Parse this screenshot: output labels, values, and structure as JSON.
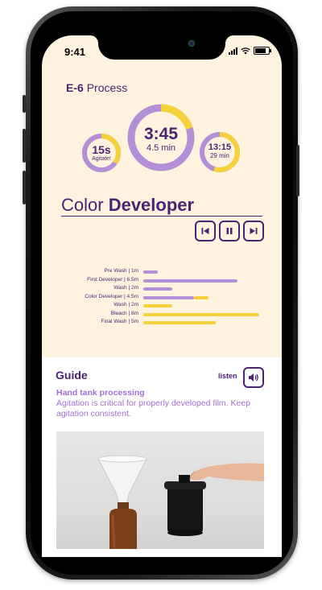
{
  "status": {
    "time": "9:41"
  },
  "process": {
    "code": "E-6",
    "word": "Process"
  },
  "timers": {
    "agitate": {
      "value": "15s",
      "label": "Agitate!",
      "progress": 0.35
    },
    "main": {
      "value": "3:45",
      "sub": "4.5 min",
      "progress": 0.2
    },
    "total": {
      "value": "13:15",
      "sub": "29 min",
      "progress": 0.55
    }
  },
  "step": {
    "prefix": "Color",
    "name": "Developer"
  },
  "controls": {
    "prev": "previous-step",
    "pause": "pause",
    "next": "next-step"
  },
  "colors": {
    "purple": "#4a2373",
    "lavender": "#b28fd6",
    "yellow": "#f5d23b",
    "background": "#fef3de"
  },
  "chart_data": {
    "type": "bar",
    "orientation": "horizontal",
    "categories": [
      "Pre Wash | 1m",
      "First Developer | 6.5m",
      "Wash | 2m",
      "Color Developer | 4.5m",
      "Wash | 2m",
      "Bleach | 8m",
      "Final Wash | 5m"
    ],
    "values": [
      1,
      6.5,
      2,
      4.5,
      2,
      8,
      5
    ],
    "completed": [
      1,
      6.5,
      2,
      3.5,
      0,
      0,
      0
    ],
    "unit": "min"
  },
  "guide": {
    "title": "Guide",
    "listen_label": "listen",
    "heading": "Hand tank processing",
    "body": "Agitation is critical for properly developed film. Keep agitation consistent."
  }
}
